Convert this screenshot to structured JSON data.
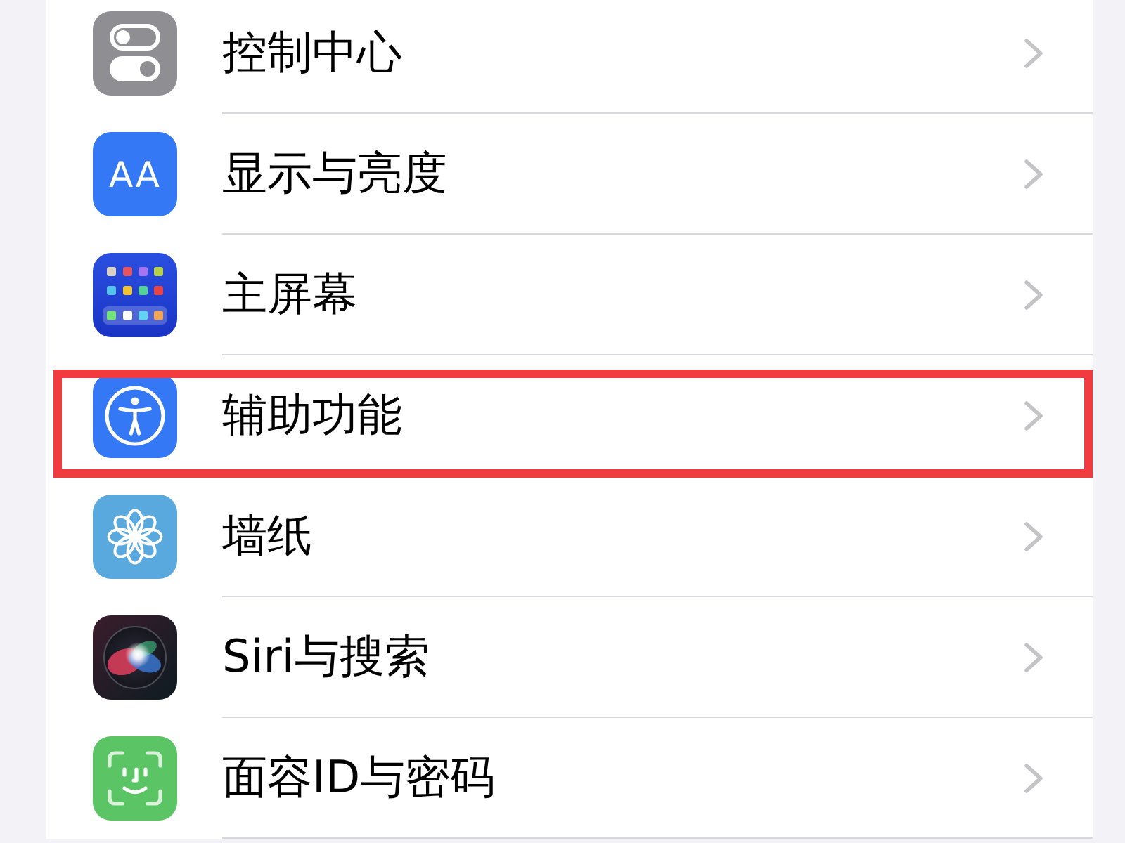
{
  "settings_list": {
    "rows": [
      {
        "kind": "toggles",
        "label": "控制中心",
        "highlighted": false
      },
      {
        "kind": "textsize",
        "label": "显示与亮度",
        "icon_text": "AA",
        "highlighted": false
      },
      {
        "kind": "grid",
        "label": "主屏幕",
        "highlighted": false
      },
      {
        "kind": "accessibility",
        "label": "辅助功能",
        "highlighted": true
      },
      {
        "kind": "flower",
        "label": "墙纸",
        "highlighted": false
      },
      {
        "kind": "siri",
        "label": "Siri与搜索",
        "highlighted": false
      },
      {
        "kind": "faceid",
        "label": "面容ID与密码",
        "highlighted": false
      }
    ]
  }
}
